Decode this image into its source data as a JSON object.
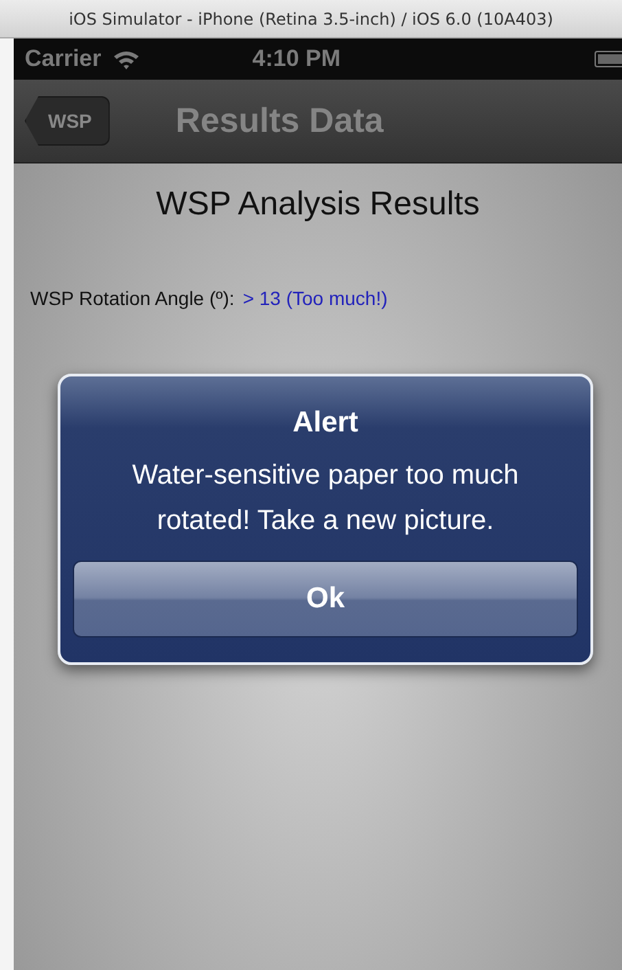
{
  "window": {
    "title": "iOS Simulator - iPhone (Retina 3.5-inch) / iOS 6.0 (10A403)"
  },
  "status_bar": {
    "carrier": "Carrier",
    "time": "4:10 PM"
  },
  "nav_bar": {
    "back_button": "WSP",
    "title": "Results Data"
  },
  "content": {
    "heading": "WSP Analysis Results",
    "fields": [
      {
        "label": "WSP Rotation Angle (º):",
        "value": "> 13 (Too much!)"
      }
    ]
  },
  "alert": {
    "title": "Alert",
    "message": "Water-sensitive paper too much rotated! Take a new picture.",
    "buttons": [
      "Ok"
    ]
  }
}
